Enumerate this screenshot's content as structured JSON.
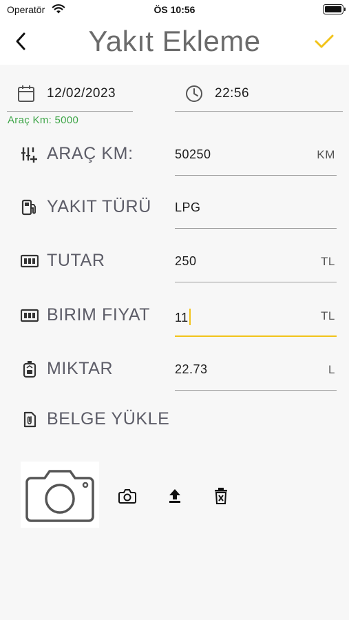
{
  "status_bar": {
    "carrier": "Operatör",
    "time": "ÖS 10:56"
  },
  "header": {
    "title": "Yakıt Ekleme",
    "back_icon": "chevron-left-icon",
    "confirm_icon": "check-icon"
  },
  "datetime": {
    "date": "12/02/2023",
    "time": "22:56",
    "helper": "Araç Km: 5000"
  },
  "fields": {
    "arac_km": {
      "label": "ARAÇ KM:",
      "value": "50250",
      "unit": "KM",
      "icon": "odometer-icon"
    },
    "yakit_turu": {
      "label": "YAKIT TÜRÜ",
      "value": "LPG",
      "icon": "fuel-pump-icon"
    },
    "tutar": {
      "label": "TUTAR",
      "value": "250",
      "unit": "TL",
      "icon": "money-icon"
    },
    "birim_fiyat": {
      "label": "BIRIM FIYAT",
      "value": "11",
      "unit": "TL",
      "icon": "money-icon"
    },
    "miktar": {
      "label": "MIKTAR",
      "value": "22.73",
      "unit": "L",
      "icon": "fuel-canister-icon"
    }
  },
  "upload": {
    "label": "BELGE YÜKLE",
    "icon": "attachment-icon"
  },
  "colors": {
    "accent": "#f2c319",
    "helper_green": "#3ea548",
    "label": "#5d5d68",
    "title": "#6b6b6b"
  }
}
